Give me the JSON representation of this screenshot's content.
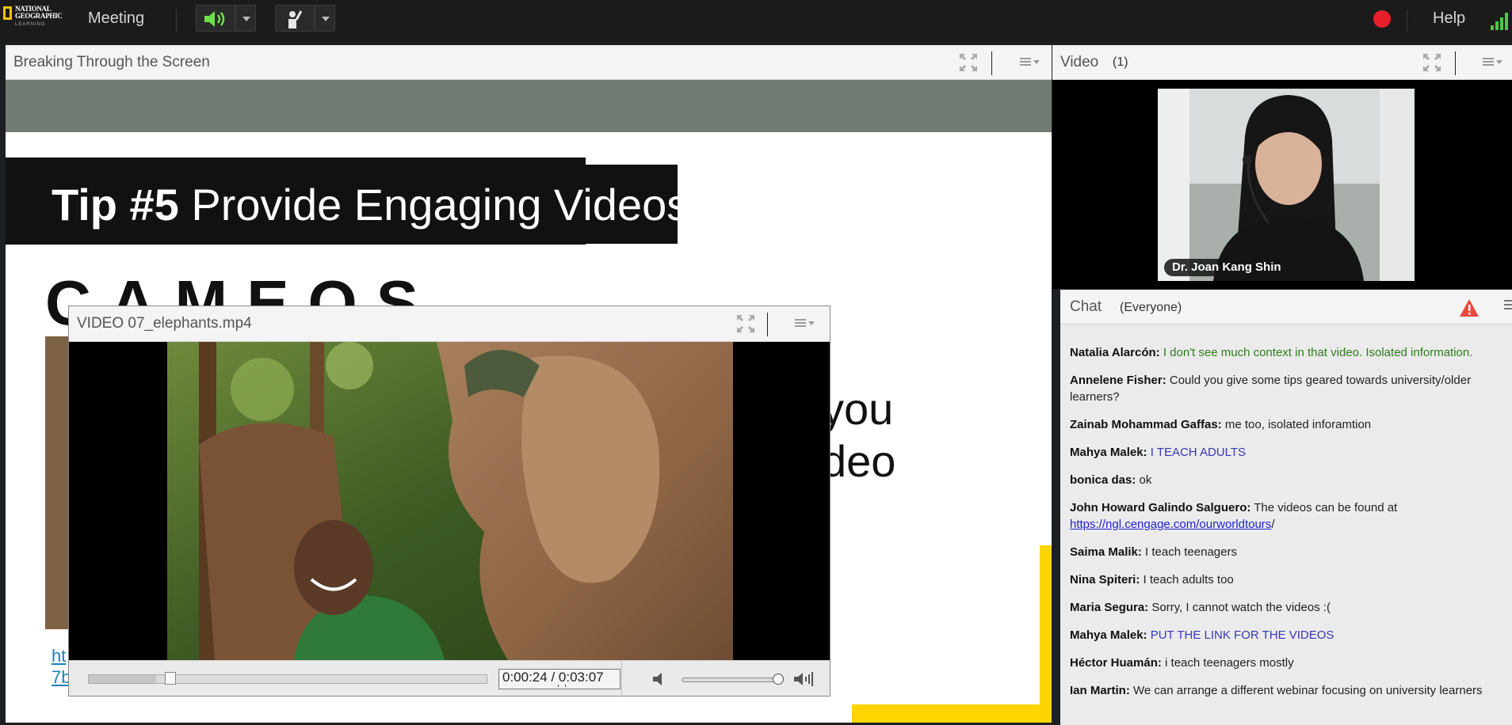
{
  "topbar": {
    "logo_line1": "NATIONAL",
    "logo_line2": "GEOGRAPHIC",
    "logo_sub": "LEARNING",
    "menu_meeting": "Meeting",
    "menu_help": "Help"
  },
  "share_pod": {
    "title": "Breaking Through the Screen",
    "slide": {
      "tip_bold": "Tip #5",
      "tip_rest": " Provide Engaging Videos",
      "section_heading": "CAMEOS",
      "partial_big_line1": "you",
      "partial_big_line2": "deo",
      "partial_link_line1": "ht",
      "partial_link_line2": "7b"
    }
  },
  "video_pod": {
    "title": "VIDEO 07_elephants.mp4",
    "time_display": "0:00:24 / 0:03:07",
    "progress_fraction": 0.17,
    "volume_fraction": 1.0
  },
  "camera_pod": {
    "title": "Video",
    "count": "(1)",
    "participant_name": "Dr. Joan Kang Shin"
  },
  "chat_pod": {
    "title": "Chat",
    "scope": "(Everyone)",
    "messages": [
      {
        "sender": "Natalia  Alarcón:",
        "text": "I don't see much context in that video. Isolated information."
      },
      {
        "sender": "Annelene  Fisher:",
        "text": "Could you give some tips geared towards university/older learners?"
      },
      {
        "sender": "Zainab Mohammad Gaffas:",
        "text": "me too, isolated inforamtion"
      },
      {
        "sender": "Mahya Malek:",
        "text": "I TEACH ADULTS"
      },
      {
        "sender": "bonica das:",
        "text": "ok"
      },
      {
        "sender": "John Howard Galindo Salguero:",
        "text": "The videos can be found at",
        "link": "https://ngl.cengage.com/ourworldtours",
        "link_suffix": "/"
      },
      {
        "sender": "Saima Malik:",
        "text": "I teach teenagers"
      },
      {
        "sender": "Nina Spiteri:",
        "text": "I teach adults too"
      },
      {
        "sender": "Maria Segura:",
        "text": "Sorry, I cannot watch the videos :("
      },
      {
        "sender": "Mahya Malek:",
        "text": "PUT THE LINK FOR THE VIDEOS"
      },
      {
        "sender": "Héctor Huamán:",
        "text": "i teach teenagers mostly"
      },
      {
        "sender": "Ian Martin:",
        "text": "We can arrange a different webinar focusing on university learners"
      }
    ]
  },
  "colors": {
    "accent_yellow": "#ffd500",
    "record_red": "#e8202a",
    "signal_green": "#4bc64b",
    "chat_green": "#2c7d1a",
    "chat_purple": "#3a36b8"
  },
  "icons": [
    "speaker-icon",
    "raise-hand-icon",
    "record-icon",
    "signal-icon",
    "fullscreen-icon",
    "pod-menu-icon",
    "warning-icon",
    "mute-icon",
    "volume-max-icon"
  ]
}
